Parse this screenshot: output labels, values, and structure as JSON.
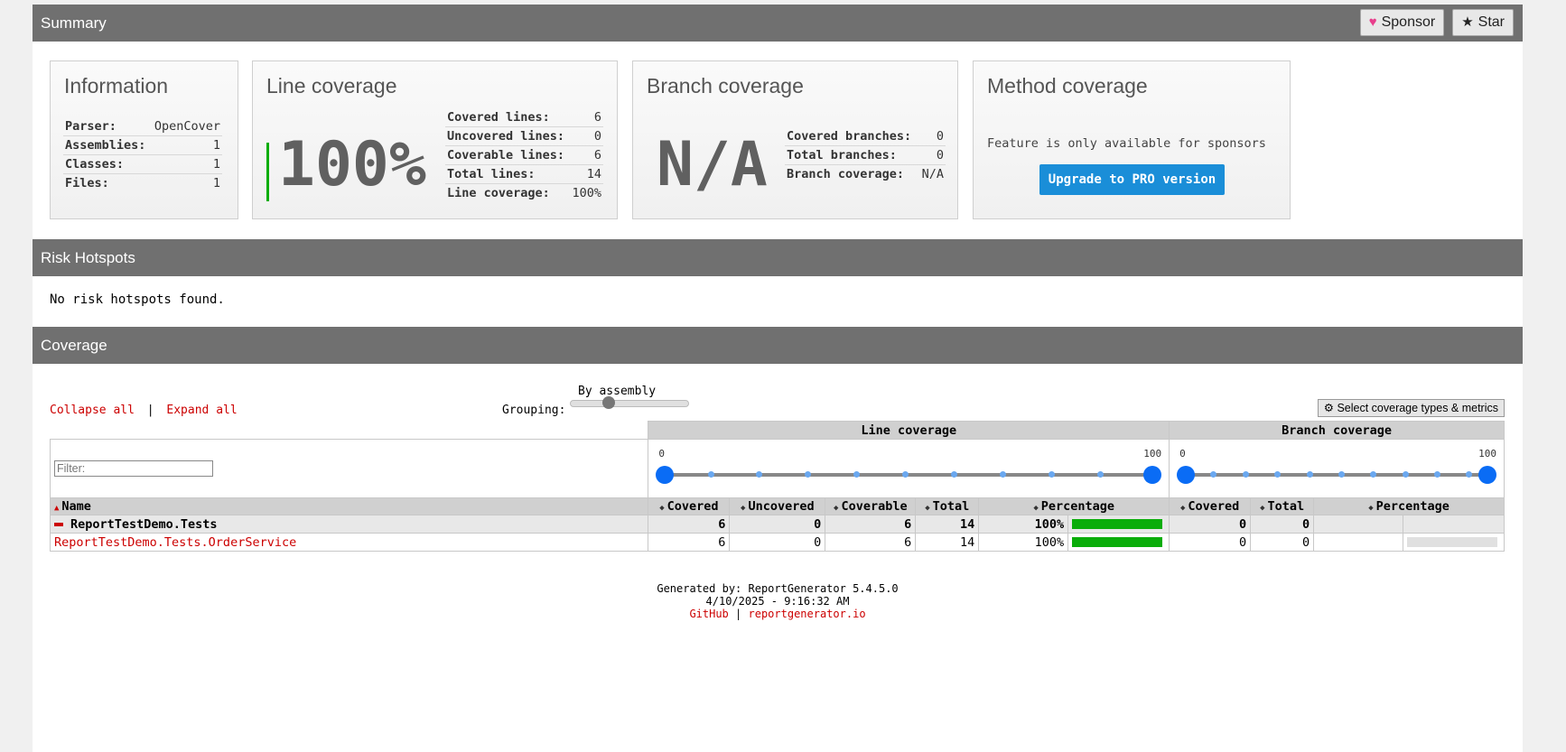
{
  "summary": {
    "title": "Summary",
    "sponsor_label": "Sponsor",
    "star_label": "Star"
  },
  "info": {
    "title": "Information",
    "rows": [
      {
        "k": "Parser:",
        "v": "OpenCover"
      },
      {
        "k": "Assemblies:",
        "v": "1"
      },
      {
        "k": "Classes:",
        "v": "1"
      },
      {
        "k": "Files:",
        "v": "1"
      }
    ]
  },
  "line": {
    "title": "Line coverage",
    "big": "100%",
    "rows": [
      {
        "k": "Covered lines:",
        "v": "6"
      },
      {
        "k": "Uncovered lines:",
        "v": "0"
      },
      {
        "k": "Coverable lines:",
        "v": "6"
      },
      {
        "k": "Total lines:",
        "v": "14"
      },
      {
        "k": "Line coverage:",
        "v": "100%"
      }
    ]
  },
  "branch": {
    "title": "Branch coverage",
    "big": "N/A",
    "rows": [
      {
        "k": "Covered branches:",
        "v": "0"
      },
      {
        "k": "Total branches:",
        "v": "0"
      },
      {
        "k": "Branch coverage:",
        "v": "N/A"
      }
    ]
  },
  "method": {
    "title": "Method coverage",
    "note": "Feature is only available for sponsors",
    "button": "Upgrade to PRO version"
  },
  "risk": {
    "title": "Risk Hotspots",
    "text": "No risk hotspots found."
  },
  "coverage": {
    "title": "Coverage",
    "collapse_all": "Collapse all",
    "sep": "|",
    "expand_all": "Expand all",
    "grouping_label": "Grouping:",
    "grouping_value": "By assembly",
    "select_button": "Select coverage types & metrics",
    "filter_placeholder": "Filter:",
    "group_headers": {
      "line": "Line coverage",
      "branch": "Branch coverage"
    },
    "line_slider": {
      "min": "0",
      "max": "100"
    },
    "branch_slider": {
      "min": "0",
      "max": "100"
    },
    "columns": {
      "name": "Name",
      "covered": "Covered",
      "uncovered": "Uncovered",
      "coverable": "Coverable",
      "total": "Total",
      "percentage": "Percentage",
      "b_covered": "Covered",
      "b_total": "Total",
      "b_percentage": "Percentage"
    },
    "assembly": {
      "name": "ReportTestDemo.Tests",
      "covered": "6",
      "uncovered": "0",
      "coverable": "6",
      "total": "14",
      "percentage": "100%",
      "b_covered": "0",
      "b_total": "0"
    },
    "class": {
      "name": "ReportTestDemo.Tests.OrderService",
      "covered": "6",
      "uncovered": "0",
      "coverable": "6",
      "total": "14",
      "percentage": "100%",
      "b_covered": "0",
      "b_total": "0"
    },
    "line_fill_fraction": 1.0,
    "branch_fill_fraction": 0.0
  },
  "footer": {
    "generated": "Generated by: ReportGenerator 5.4.5.0",
    "date": "4/10/2025 - 9:16:32 AM",
    "github": "GitHub",
    "sep": "|",
    "site": "reportgenerator.io"
  },
  "colors": {
    "header_bg": "#707070",
    "bar_green": "#0aad0a",
    "link_red": "#cc0000",
    "pro_blue": "#1a8ed8",
    "heart_pink": "#e83e8c"
  }
}
